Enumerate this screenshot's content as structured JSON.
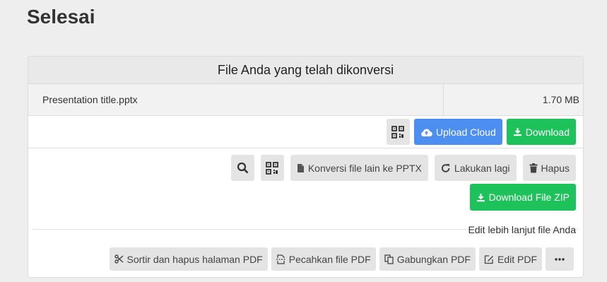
{
  "page": {
    "title": "Selesai"
  },
  "panel": {
    "header": "File Anda yang telah dikonversi",
    "file": {
      "name": "Presentation title.pptx",
      "size": "1.70 MB"
    },
    "actions": {
      "qr_icon": "qr-code-icon",
      "upload_cloud": "Upload Cloud",
      "download": "Download"
    }
  },
  "tools": {
    "search_icon": "search-icon",
    "qr_icon": "qr-code-icon",
    "convert_other": "Konversi file lain ke PPTX",
    "redo": "Lakukan lagi",
    "delete": "Hapus",
    "download_zip": "Download File ZIP",
    "edit_label": "Edit lebih lanjut file Anda",
    "edit_actions": {
      "sort": "Sortir dan hapus halaman PDF",
      "split": "Pecahkan file PDF",
      "merge": "Gabungkan PDF",
      "edit": "Edit PDF",
      "more_icon": "ellipsis-icon"
    }
  },
  "colors": {
    "blue": "#4d8ff0",
    "green": "#1ec25b",
    "button_gray": "#e4e4e4"
  }
}
